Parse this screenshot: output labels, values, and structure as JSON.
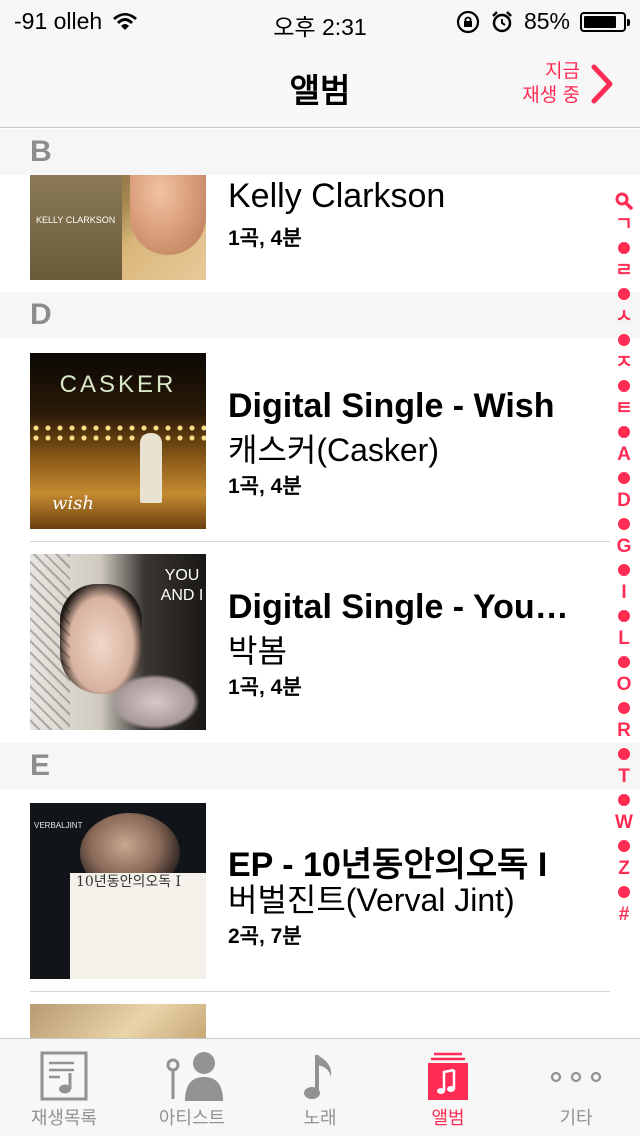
{
  "status_bar": {
    "carrier": "-91 olleh",
    "time": "오후 2:31",
    "battery": "85%",
    "battery_level": 0.85
  },
  "nav": {
    "title": "앨범",
    "now_playing_line1": "지금",
    "now_playing_line2": "재생 중"
  },
  "sections": [
    {
      "letter": "B"
    },
    {
      "letter": "D"
    },
    {
      "letter": "E"
    }
  ],
  "albums": [
    {
      "title": "Kelly Clarkson",
      "artist": "",
      "meta": "1곡, 4분",
      "cover_text": "KELLY CLARKSON"
    },
    {
      "title": "Digital Single - Wish",
      "artist": "캐스커(Casker)",
      "meta": "1곡, 4분",
      "cover_text": "CASKER",
      "cover_sub": "wish"
    },
    {
      "title": "Digital Single - You…",
      "artist": "박봄",
      "meta": "1곡, 4분",
      "cover_text": "YOU AND I"
    },
    {
      "title": "EP - 10년동안의오독 I",
      "artist": "버벌진트(Verval Jint)",
      "meta": "2곡, 7분",
      "cover_text": "10년동안의오독 I",
      "cover_brand": "VERBALJINT"
    }
  ],
  "index_bar": [
    "ㄱ",
    "ㄹ",
    "ㅅ",
    "ㅈ",
    "ㅌ",
    "A",
    "D",
    "G",
    "I",
    "L",
    "O",
    "R",
    "T",
    "W",
    "Z",
    "#"
  ],
  "tabs": [
    {
      "label": "재생목록",
      "icon": "playlist-icon"
    },
    {
      "label": "아티스트",
      "icon": "artist-icon"
    },
    {
      "label": "노래",
      "icon": "music-note-icon"
    },
    {
      "label": "앨범",
      "icon": "album-icon",
      "active": true
    },
    {
      "label": "기타",
      "icon": "more-icon"
    }
  ],
  "colors": {
    "accent": "#ff2d55",
    "inactive": "#929292",
    "section_text": "#8d8d8d"
  }
}
